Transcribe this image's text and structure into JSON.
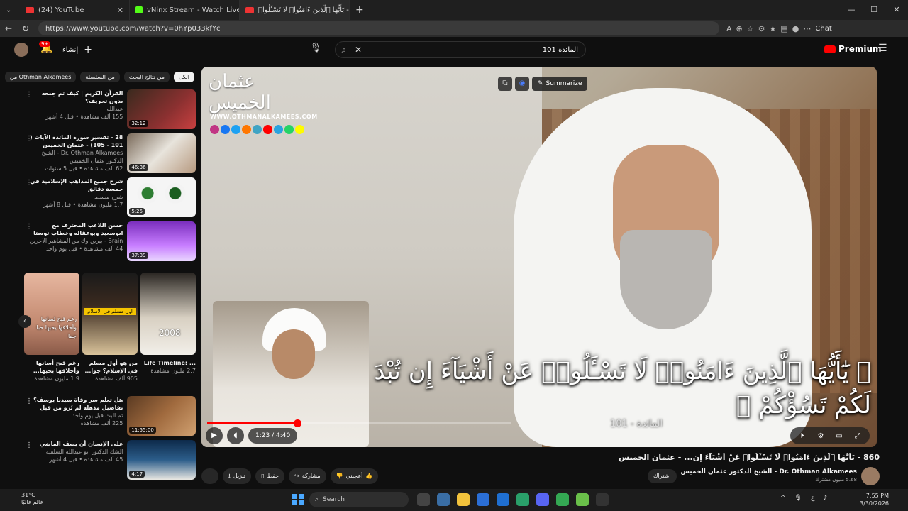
{
  "browser": {
    "tabs": [
      {
        "label": "(24) YouTube"
      },
      {
        "label": "vNinx Stream - Watch Live on Kick"
      },
      {
        "label": "(24) 860 - يَأَيُّهَا ٱلَّذِينَ ءَامَنُوا۟ لَا تَسْـَٔلُوا۟"
      }
    ],
    "url": "https://www.youtube.com/watch?v=0hYp033kfYc",
    "chat_label": "Chat"
  },
  "header": {
    "notification_count": "9+",
    "create_label": "إنشاء",
    "search_value": "المائدة 101",
    "premium_label": "Premium"
  },
  "chips": [
    {
      "label": "الكل",
      "active": true
    },
    {
      "label": "من نتائج البحث"
    },
    {
      "label": "من السلسلة"
    },
    {
      "label": "Othman Alkamees من"
    }
  ],
  "recommendations": [
    {
      "title": "القرآن الكريم | كيف تم جمعه بدون تحريف؟",
      "channel": "عبدالله",
      "stats": "155 ألف مشاهدة • قبل 4 أشهر",
      "duration": "32:12"
    },
    {
      "title": "28 - تفسير سورة المائدة الآيات ( 101 - 105) - عثمان الخميس",
      "channel": "Dr. Othman Alkamees - الشيخ الدكتور عثمان الخميس",
      "stats": "62 ألف مشاهدة • قبل 5 سنوات",
      "duration": "46:36"
    },
    {
      "title": "شرح جميع المذاهب الإسلامية في خمسة دقائق",
      "channel": "شرح مبسط",
      "stats": "1.7 مليون مشاهدة • قبل 8 أشهر",
      "duration": "5:25"
    },
    {
      "title": "حسن اللاعب المحترف مع ابوسعيد ويوعقاله وخطاب توستا",
      "channel": "Brain - بيرين وك من المشاهير الآخرين",
      "stats": "44 ألف مشاهدة • قبل يوم واحد",
      "duration": "37:39"
    },
    {
      "title": "هل تعلم سر وفاة سيدنا يوسف؟ تفاصيل مذهلة لم تُروَ من قبل",
      "channel": "تم البث قبل يوم واحد",
      "stats": "225 ألف مشاهدة",
      "duration": "11:55:00"
    },
    {
      "title": "على الإنسان أن يصف الماضي",
      "channel": "الشك الدكتور ابو عبدالله السلفية",
      "stats": "45 ألف مشاهدة • قبل 4 أشهر",
      "duration": "4:17"
    }
  ],
  "shorts": [
    {
      "title": "رغم قبح أسانها وأخلاقها يحبها...",
      "views": "1.9 مليون مشاهدة"
    },
    {
      "title": "من هو أول مسلم في الإسلام؟ جوا...",
      "views": "905 ألف مشاهدة"
    },
    {
      "title": "Life Timeline: ...",
      "views": "2.7 مليون مشاهدة"
    }
  ],
  "shorts_overlay": {
    "caption": "رغم قبح لسانها وأخلاقها يحبها حبا جما",
    "badge": "اول مسلم في الاسلام",
    "year": "2008"
  },
  "player": {
    "brand_name": "عثمان الخميس",
    "brand_site": "WWW.OTHMANALKAMEES.COM",
    "summarize_label": "Summarize",
    "verse_text": "﴿ يَٰٓأَيُّهَا ٱلَّذِينَ ءَامَنُوا۟ لَا تَسْـَٔلُوا۟ عَنْ أَشْيَآءَ إِن تُبْدَ لَكُمْ تَسُؤْكُمْ ﴾",
    "surah_ref": "المائدة - 101",
    "time": "1:23 / 4:40",
    "progress": 0.296
  },
  "video": {
    "title": "860 - يَأَيُّهَا ٱلَّذِينَ ءَامَنُوا۟ لَا تَسْـَٔلُوا۟ عَنْ أَشْيَآءَ إِن... - عثمان الخميس",
    "channel_name": "Dr. Othman Alkamees - الشيخ الدكتور عثمان الخميس",
    "subscribers": "5.68 مليون مشترك",
    "subscribe_label": "اشتراك",
    "like_label": "أعجبني",
    "share_label": "مشاركة",
    "save_label": "حفظ",
    "download_label": "تنزيل"
  },
  "taskbar": {
    "temperature": "31°C",
    "weather_text": "غائم غالبًا",
    "search_label": "Search",
    "time": "7:55 PM",
    "date": "3/30/2026"
  }
}
